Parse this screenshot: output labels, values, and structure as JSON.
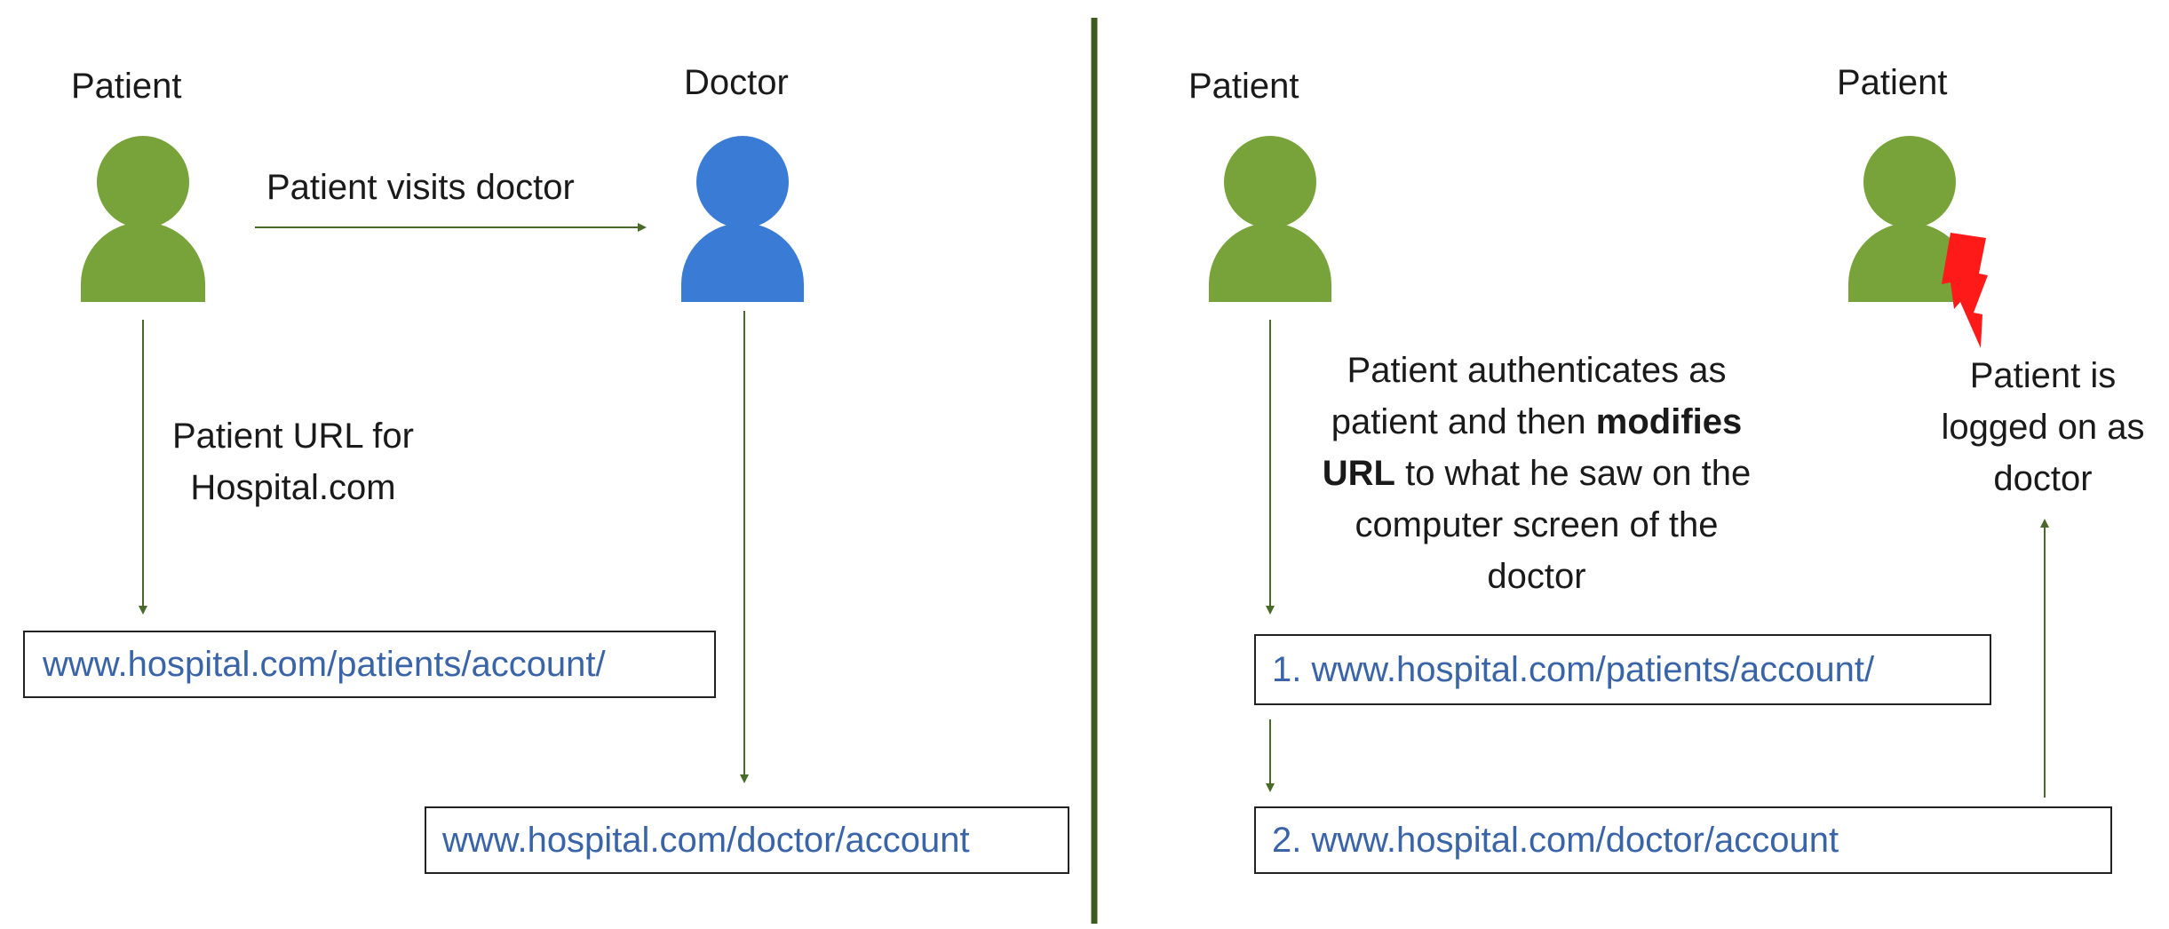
{
  "left_panel": {
    "patient_label": "Patient",
    "doctor_label": "Doctor",
    "visit_label": "Patient visits doctor",
    "url_caption": [
      "Patient URL for",
      "Hospital.com"
    ],
    "patient_url": "www.hospital.com/patients/account/",
    "doctor_url": "www.hospital.com/doctor/account"
  },
  "right_panel": {
    "patient_label": "Patient",
    "patient_as_doctor_label": "Patient",
    "attack_caption": {
      "line1": "Patient authenticates as",
      "line2_pre": "patient and then ",
      "line2_bold": "modifies",
      "line3_bold": "URL",
      "line3_post": " to what he saw on the",
      "line4": "computer screen of the",
      "line5": "doctor"
    },
    "result_caption": [
      "Patient is",
      "logged on as",
      "doctor"
    ],
    "step1_url": "1. www.hospital.com/patients/account/",
    "step2_url": "2. www.hospital.com/doctor/account"
  },
  "colors": {
    "patient": "#77a33a",
    "doctor": "#3a7bd5",
    "arrow": "#4a6a2a",
    "divider": "#3d5a1f",
    "url_text": "#3a64a8",
    "attack_bolt": "#ff1a1a"
  },
  "icons": [
    "person-icon",
    "lightning-bolt-icon"
  ]
}
